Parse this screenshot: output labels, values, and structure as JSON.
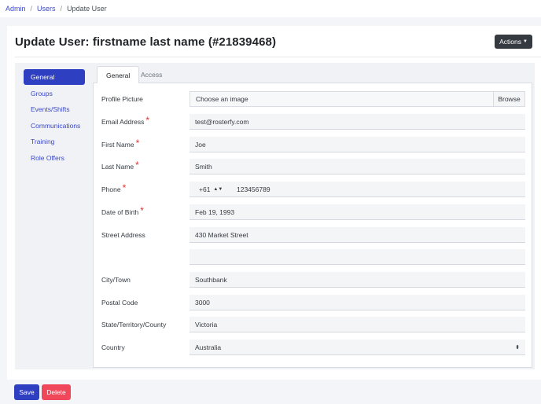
{
  "breadcrumb": {
    "items": [
      "Admin",
      "Users"
    ],
    "current": "Update User"
  },
  "header": {
    "title": "Update User: firstname last name (#21839468)",
    "actions_label": "Actions"
  },
  "sidebar": {
    "items": [
      {
        "label": "General"
      },
      {
        "label": "Groups"
      },
      {
        "label": "Events/Shifts"
      },
      {
        "label": "Communications"
      },
      {
        "label": "Training"
      },
      {
        "label": "Role Offers"
      }
    ],
    "active_index": 0
  },
  "tabs": [
    {
      "label": "General"
    },
    {
      "label": "Access"
    }
  ],
  "form": {
    "profile_picture": {
      "label": "Profile Picture",
      "placeholder": "Choose an image",
      "browse_label": "Browse"
    },
    "email": {
      "label": "Email Address",
      "value": "test@rosterfy.com",
      "required": "*"
    },
    "first_name": {
      "label": "First Name",
      "value": "Joe",
      "required": "*"
    },
    "last_name": {
      "label": "Last Name",
      "value": "Smith",
      "required": "*"
    },
    "phone": {
      "label": "Phone",
      "prefix": "+61",
      "value": "123456789",
      "required": "*"
    },
    "dob": {
      "label": "Date of Birth",
      "value": "Feb 19, 1993",
      "required": "*"
    },
    "street": {
      "label": "Street Address",
      "line1": "430 Market Street",
      "line2": ""
    },
    "city": {
      "label": "City/Town",
      "value": "Southbank"
    },
    "postcode": {
      "label": "Postal Code",
      "value": "3000"
    },
    "state": {
      "label": "State/Territory/County",
      "value": "Victoria"
    },
    "country": {
      "label": "Country",
      "value": "Australia"
    }
  },
  "footer": {
    "save_label": "Save",
    "delete_label": "Delete"
  },
  "colors": {
    "primary": "#2f3fc1",
    "danger": "#f0485a",
    "dark": "#343a40",
    "required": "#e03131"
  }
}
